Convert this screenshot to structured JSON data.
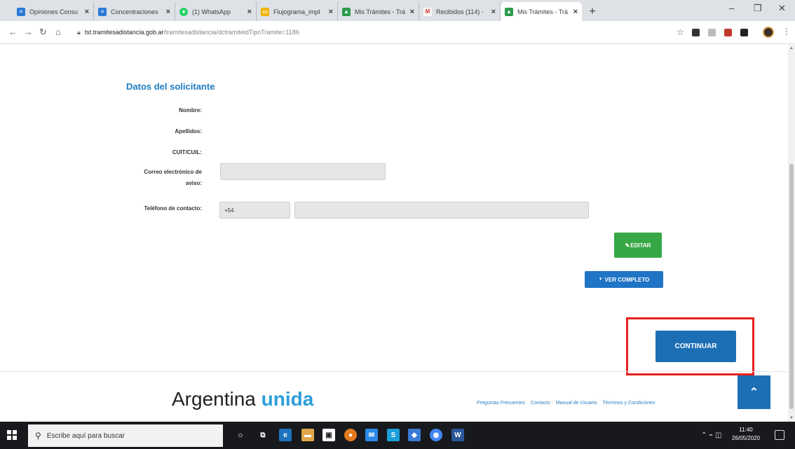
{
  "browser": {
    "tabs": [
      {
        "label": "Opiniones Consu",
        "fav_color": "#2b79d6"
      },
      {
        "label": "Concentraciones",
        "fav_color": "#2b79d6"
      },
      {
        "label": "(1) WhatsApp",
        "fav_color": "#25d366"
      },
      {
        "label": "Flujograma_impl",
        "fav_color": "#f4b400"
      },
      {
        "label": "Mis Trámites - Trá",
        "fav_color": "#2d9a4e"
      },
      {
        "label": "Recibidos (114) -",
        "fav_color": "#d93025"
      },
      {
        "label": "Mis Trámites - Trá",
        "fav_color": "#2d9a4e"
      }
    ],
    "url_host": "tst.tramitesadistancia.gob.ar",
    "url_path": "/tramitesadistancia/dctramiteidTipoTramite=1186"
  },
  "form": {
    "section_title": "Datos del solicitante",
    "labels": {
      "nombre": "Nombre:",
      "apellidos": "Apellidos:",
      "cuit": "CUIT/CUIL:",
      "correo_line1": "Correo electrónico de",
      "correo_line2": "aviso:",
      "telefono": "Teléfono de contacto:"
    },
    "values": {
      "correo": "",
      "telefono_prefix": "+54",
      "telefono_number": ""
    }
  },
  "buttons": {
    "editar": "EDITAR",
    "ver_completo": "VER COMPLETO",
    "continuar": "CONTINUAR"
  },
  "footer": {
    "brand_main": "Argentina",
    "brand_accent": "unida",
    "links": [
      "Preguntas Frecuentes",
      "Contacto",
      "Manual de Usuario",
      "Términos y Condiciones"
    ]
  },
  "taskbar": {
    "search_placeholder": "Escribe aquí para buscar",
    "time": "11:40",
    "date": "26/05/2020"
  },
  "colors": {
    "section_title": "#1f7bc0",
    "editar": "#37a845",
    "primary": "#1d6fb5",
    "highlight_box": "#e82020"
  }
}
